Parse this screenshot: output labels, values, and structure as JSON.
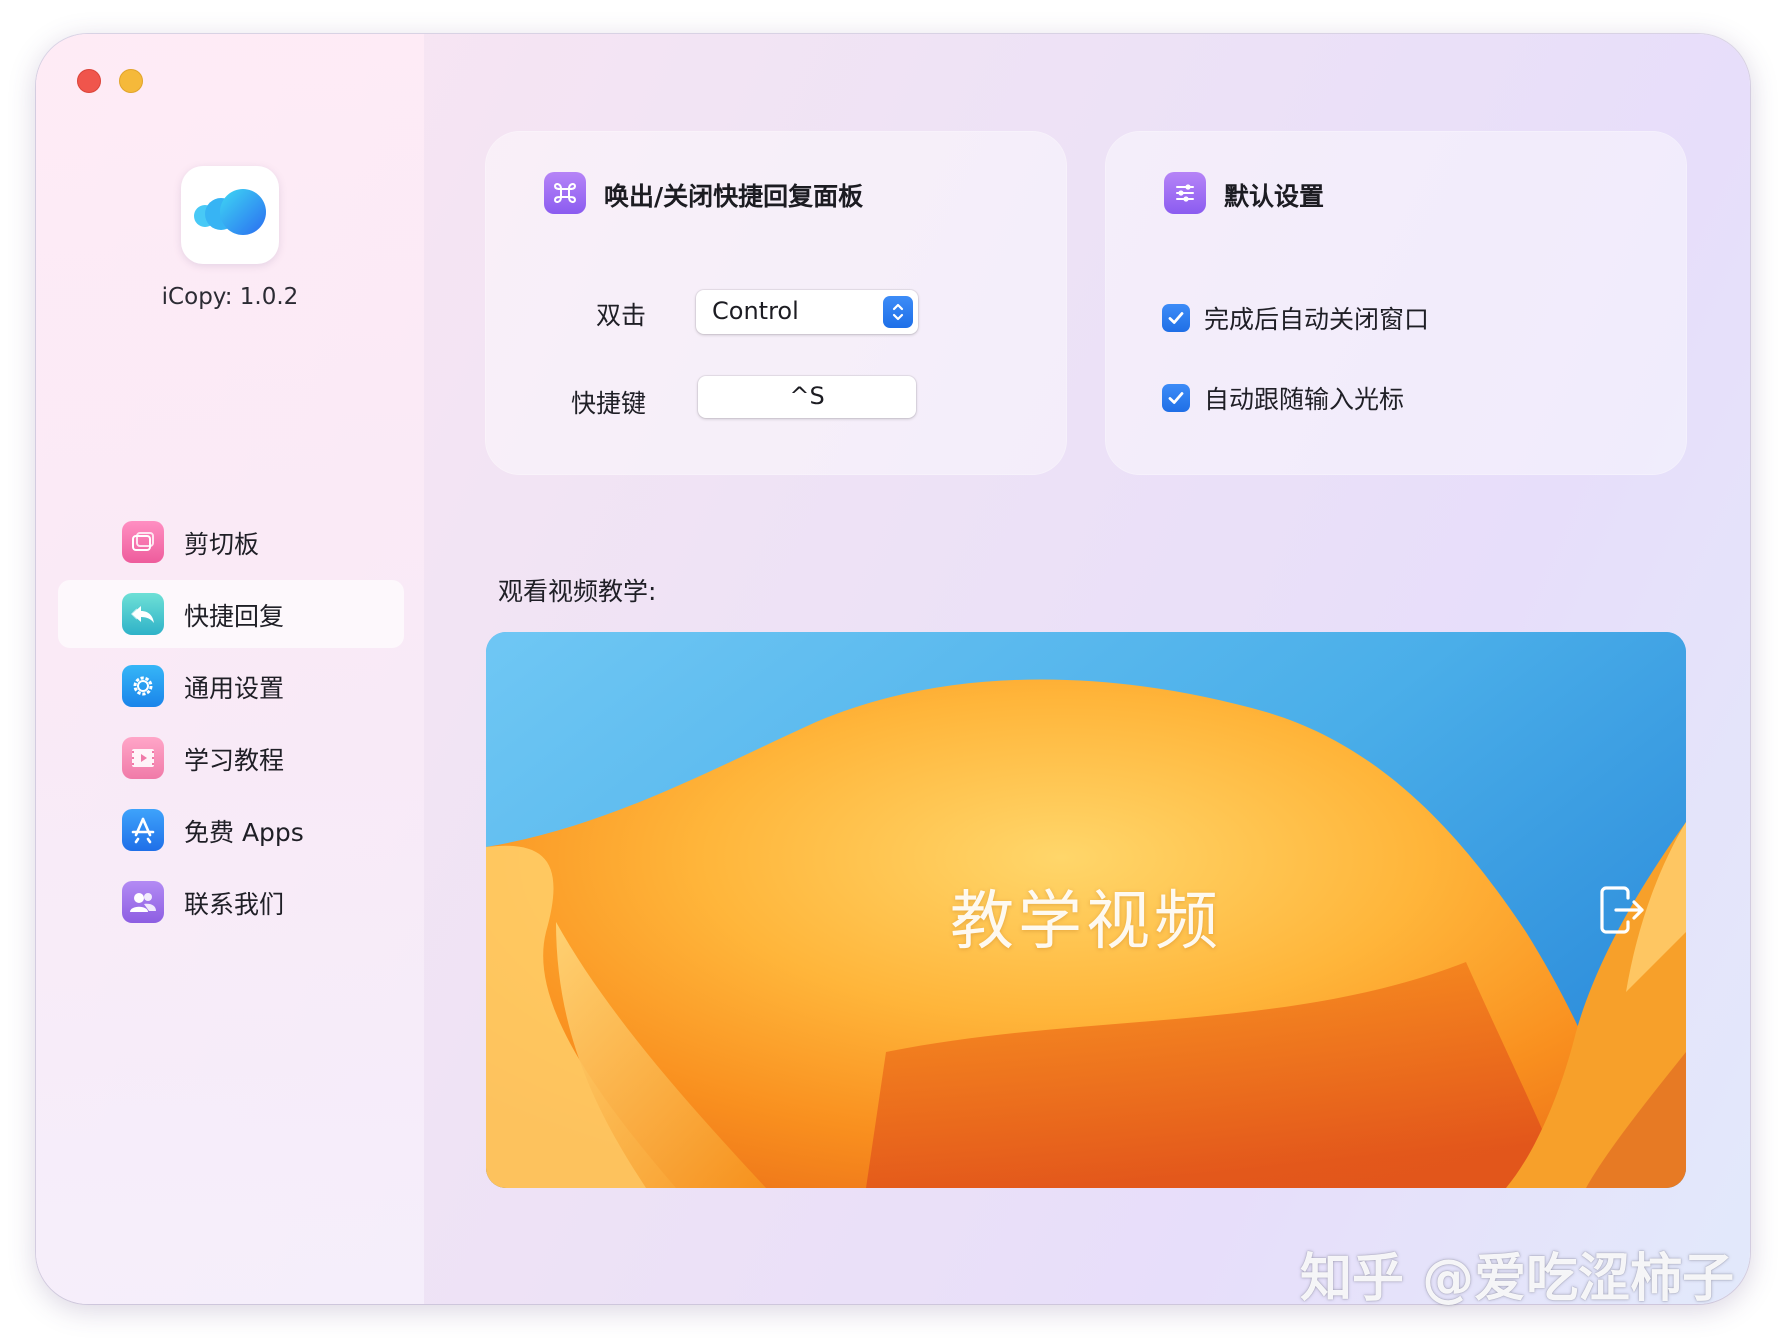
{
  "app": {
    "version_label": "iCopy: 1.0.2",
    "logo_icon": "cloud-bubbles-icon"
  },
  "sidebar": {
    "items": [
      {
        "label": "剪切板",
        "icon": "clipboard-icon",
        "color": "#f06aa6",
        "active": false
      },
      {
        "label": "快捷回复",
        "icon": "reply-icon",
        "color": "#3cc3c9",
        "active": true
      },
      {
        "label": "通用设置",
        "icon": "gear-icon",
        "color": "#1e9bf0",
        "active": false
      },
      {
        "label": "学习教程",
        "icon": "video-tutorial-icon",
        "color": "#f58bb3",
        "active": false
      },
      {
        "label": "免费 Apps",
        "icon": "app-store-icon",
        "color": "#2f8bf2",
        "active": false
      },
      {
        "label": "联系我们",
        "icon": "contacts-icon",
        "color": "#a070e8",
        "active": false
      }
    ]
  },
  "shortcut_panel": {
    "title": "唤出/关闭快捷回复面板",
    "title_icon": "command-key-icon",
    "double_click_label": "双击",
    "double_click_value": "Control",
    "hotkey_label": "快捷键",
    "hotkey_value": "^S"
  },
  "defaults_panel": {
    "title": "默认设置",
    "title_icon": "sliders-icon",
    "options": [
      {
        "label": "完成后自动关闭窗口",
        "checked": true
      },
      {
        "label": "自动跟随输入光标",
        "checked": true
      }
    ]
  },
  "video": {
    "section_label": "观看视频教学:",
    "title": "教学视频",
    "open_icon": "open-external-icon"
  },
  "watermark": "知乎 @爱吃涩柿子",
  "colors": {
    "accent": "#2a7bf0",
    "window_bg": "#efe3f5"
  }
}
